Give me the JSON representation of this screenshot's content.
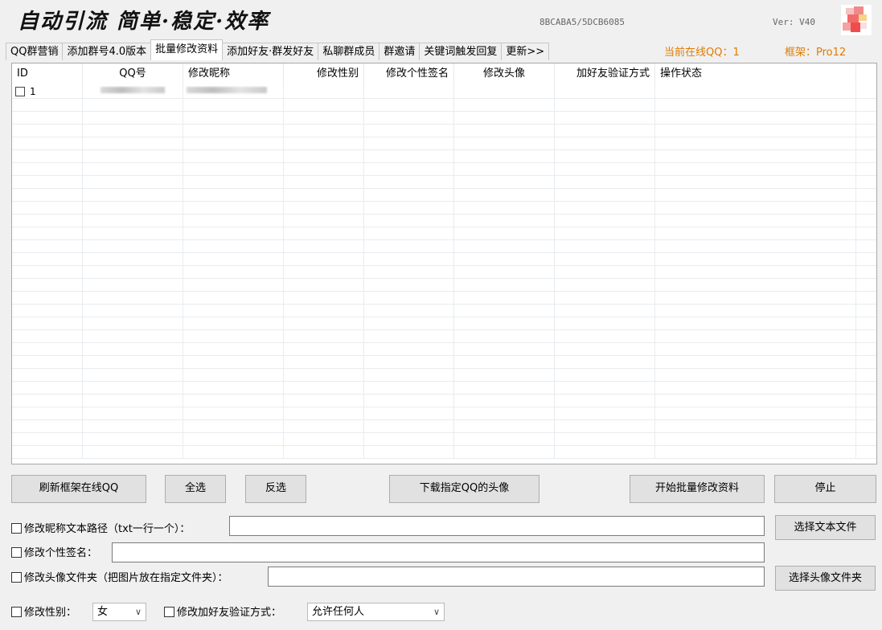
{
  "header": {
    "brand": "自动引流 简单·稳定·效率",
    "machine_code": "8BCABA5/5DCB6085",
    "version": "Ver: V40",
    "logo_icon": "pixelated-avatar-icon"
  },
  "tabs": [
    {
      "label": "QQ群营销",
      "active": false
    },
    {
      "label": "添加群号4.0版本",
      "active": false
    },
    {
      "label": "批量修改资料",
      "active": true
    },
    {
      "label": "添加好友·群发好友",
      "active": false
    },
    {
      "label": "私聊群成员",
      "active": false
    },
    {
      "label": "群邀请",
      "active": false
    },
    {
      "label": "关键词触发回复",
      "active": false
    },
    {
      "label": "更新>>",
      "active": false
    }
  ],
  "status": {
    "online": "当前在线QQ：1",
    "frame": "框架：Pro12",
    "accent_color": "#e07b00"
  },
  "table": {
    "columns": [
      "ID",
      "QQ号",
      "修改昵称",
      "修改性别",
      "修改个性签名",
      "修改头像",
      "加好友验证方式",
      "操作状态"
    ],
    "rows": [
      {
        "id": "1",
        "qq": "",
        "nickname": "",
        "gender": "",
        "signature": "",
        "avatar": "",
        "verify": "",
        "status": "",
        "redacted": true
      }
    ]
  },
  "buttons": {
    "refresh": "刷新框架在线QQ",
    "select_all": "全选",
    "invert": "反选",
    "download_avatar": "下载指定QQ的头像",
    "start": "开始批量修改资料",
    "stop": "停止",
    "choose_text": "选择文本文件",
    "choose_avatar_folder": "选择头像文件夹"
  },
  "form": {
    "nickname_path_label": "修改昵称文本路径（txt一行一个）：",
    "nickname_path_value": "",
    "signature_label": "修改个性签名：",
    "signature_value": "",
    "avatar_folder_label": "修改头像文件夹（把图片放在指定文件夹）：",
    "avatar_folder_value": "",
    "gender_label": "修改性别：",
    "gender_value": "女",
    "verify_label": "修改加好友验证方式：",
    "verify_value": "允许任何人"
  }
}
